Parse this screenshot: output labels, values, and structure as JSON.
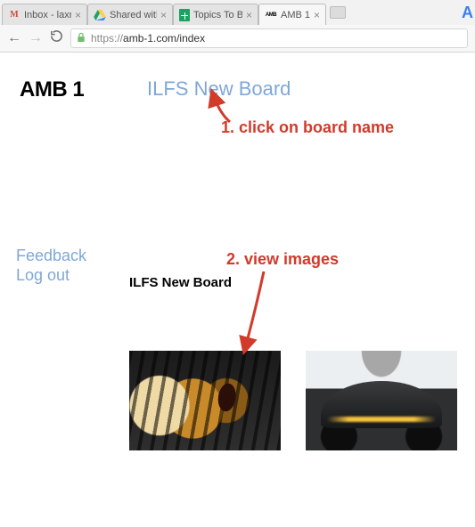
{
  "browser": {
    "tabs": [
      {
        "label": "Inbox - laxman@ilo",
        "favicon": "gmail",
        "active": false
      },
      {
        "label": "Shared with me - G",
        "favicon": "drive",
        "active": false
      },
      {
        "label": "Topics To Be Worke",
        "favicon": "sheets",
        "active": false
      },
      {
        "label": "AMB 1",
        "favicon": "amb",
        "active": true
      }
    ],
    "url_proto": "https://",
    "url_host": "amb-1.com",
    "url_path": "/index"
  },
  "page": {
    "logo": "AMB 1",
    "board_link": "ILFS New Board",
    "feedback": "Feedback",
    "logout": "Log out",
    "board_title": "ILFS New Board"
  },
  "annotations": {
    "step1": "1. click on board name",
    "step2": "2. view images"
  }
}
